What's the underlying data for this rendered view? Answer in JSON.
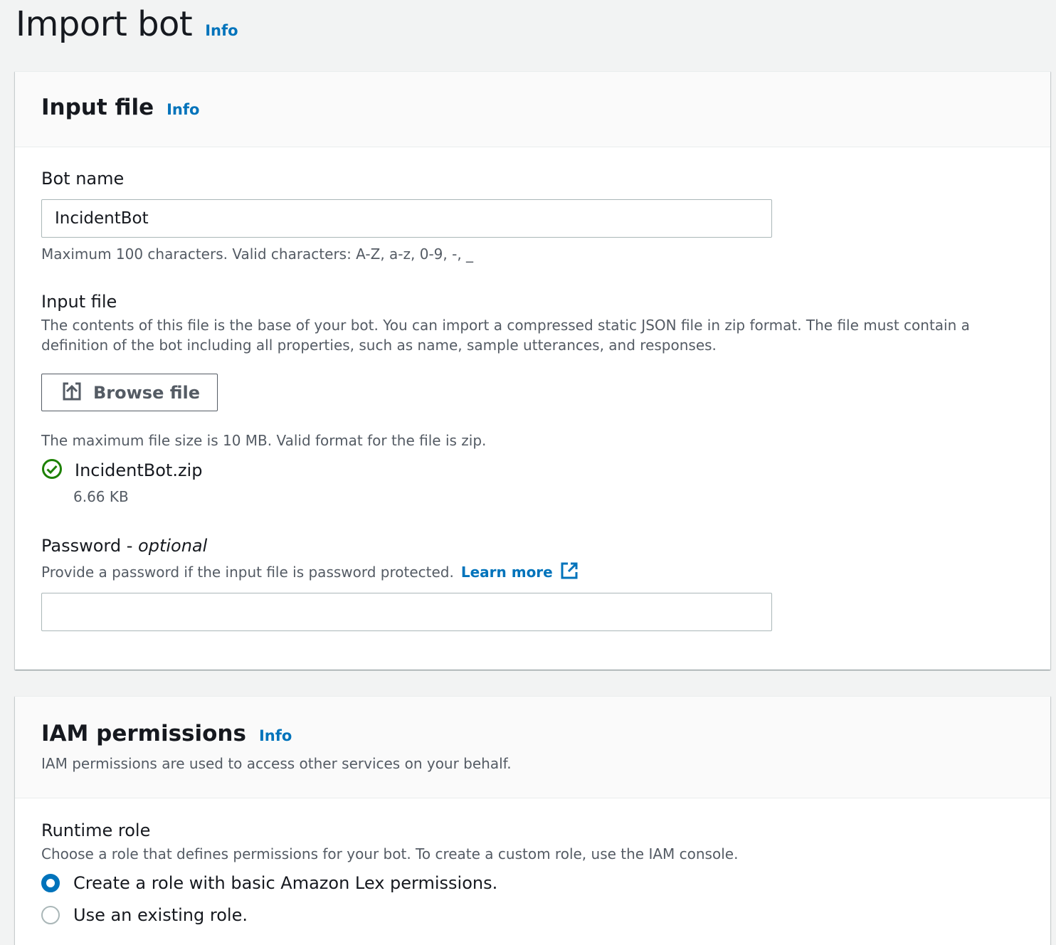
{
  "header": {
    "title": "Import bot",
    "info_label": "Info"
  },
  "input_panel": {
    "title": "Input file",
    "info_label": "Info",
    "bot_name": {
      "label": "Bot name",
      "value": "IncidentBot",
      "hint": "Maximum 100 characters. Valid characters: A-Z, a-z, 0-9, -, _"
    },
    "input_file": {
      "label": "Input file",
      "description": "The contents of this file is the base of your bot. You can import a compressed static JSON file in zip format. The file must contain a definition of the bot including all properties, such as name, sample utterances, and responses.",
      "browse_label": "Browse file",
      "hint": "The maximum file size is 10 MB. Valid format for the file is zip.",
      "file_name": "IncidentBot.zip",
      "file_size": "6.66 KB"
    },
    "password": {
      "label": "Password - ",
      "label_optional": "optional",
      "description": "Provide a password if the input file is password protected.",
      "learn_more": "Learn more",
      "value": ""
    }
  },
  "iam_panel": {
    "title": "IAM permissions",
    "info_label": "Info",
    "description": "IAM permissions are used to access other services on your behalf.",
    "runtime_role": {
      "label": "Runtime role",
      "description": "Choose a role that defines permissions for your bot. To create a custom role, use the IAM console.",
      "options": [
        {
          "label": "Create a role with basic Amazon Lex permissions.",
          "selected": true
        },
        {
          "label": "Use an existing role.",
          "selected": false
        }
      ]
    }
  },
  "colors": {
    "link": "#0073bb",
    "success": "#1d8102",
    "text": "#16191f",
    "secondary_text": "#545b64"
  }
}
